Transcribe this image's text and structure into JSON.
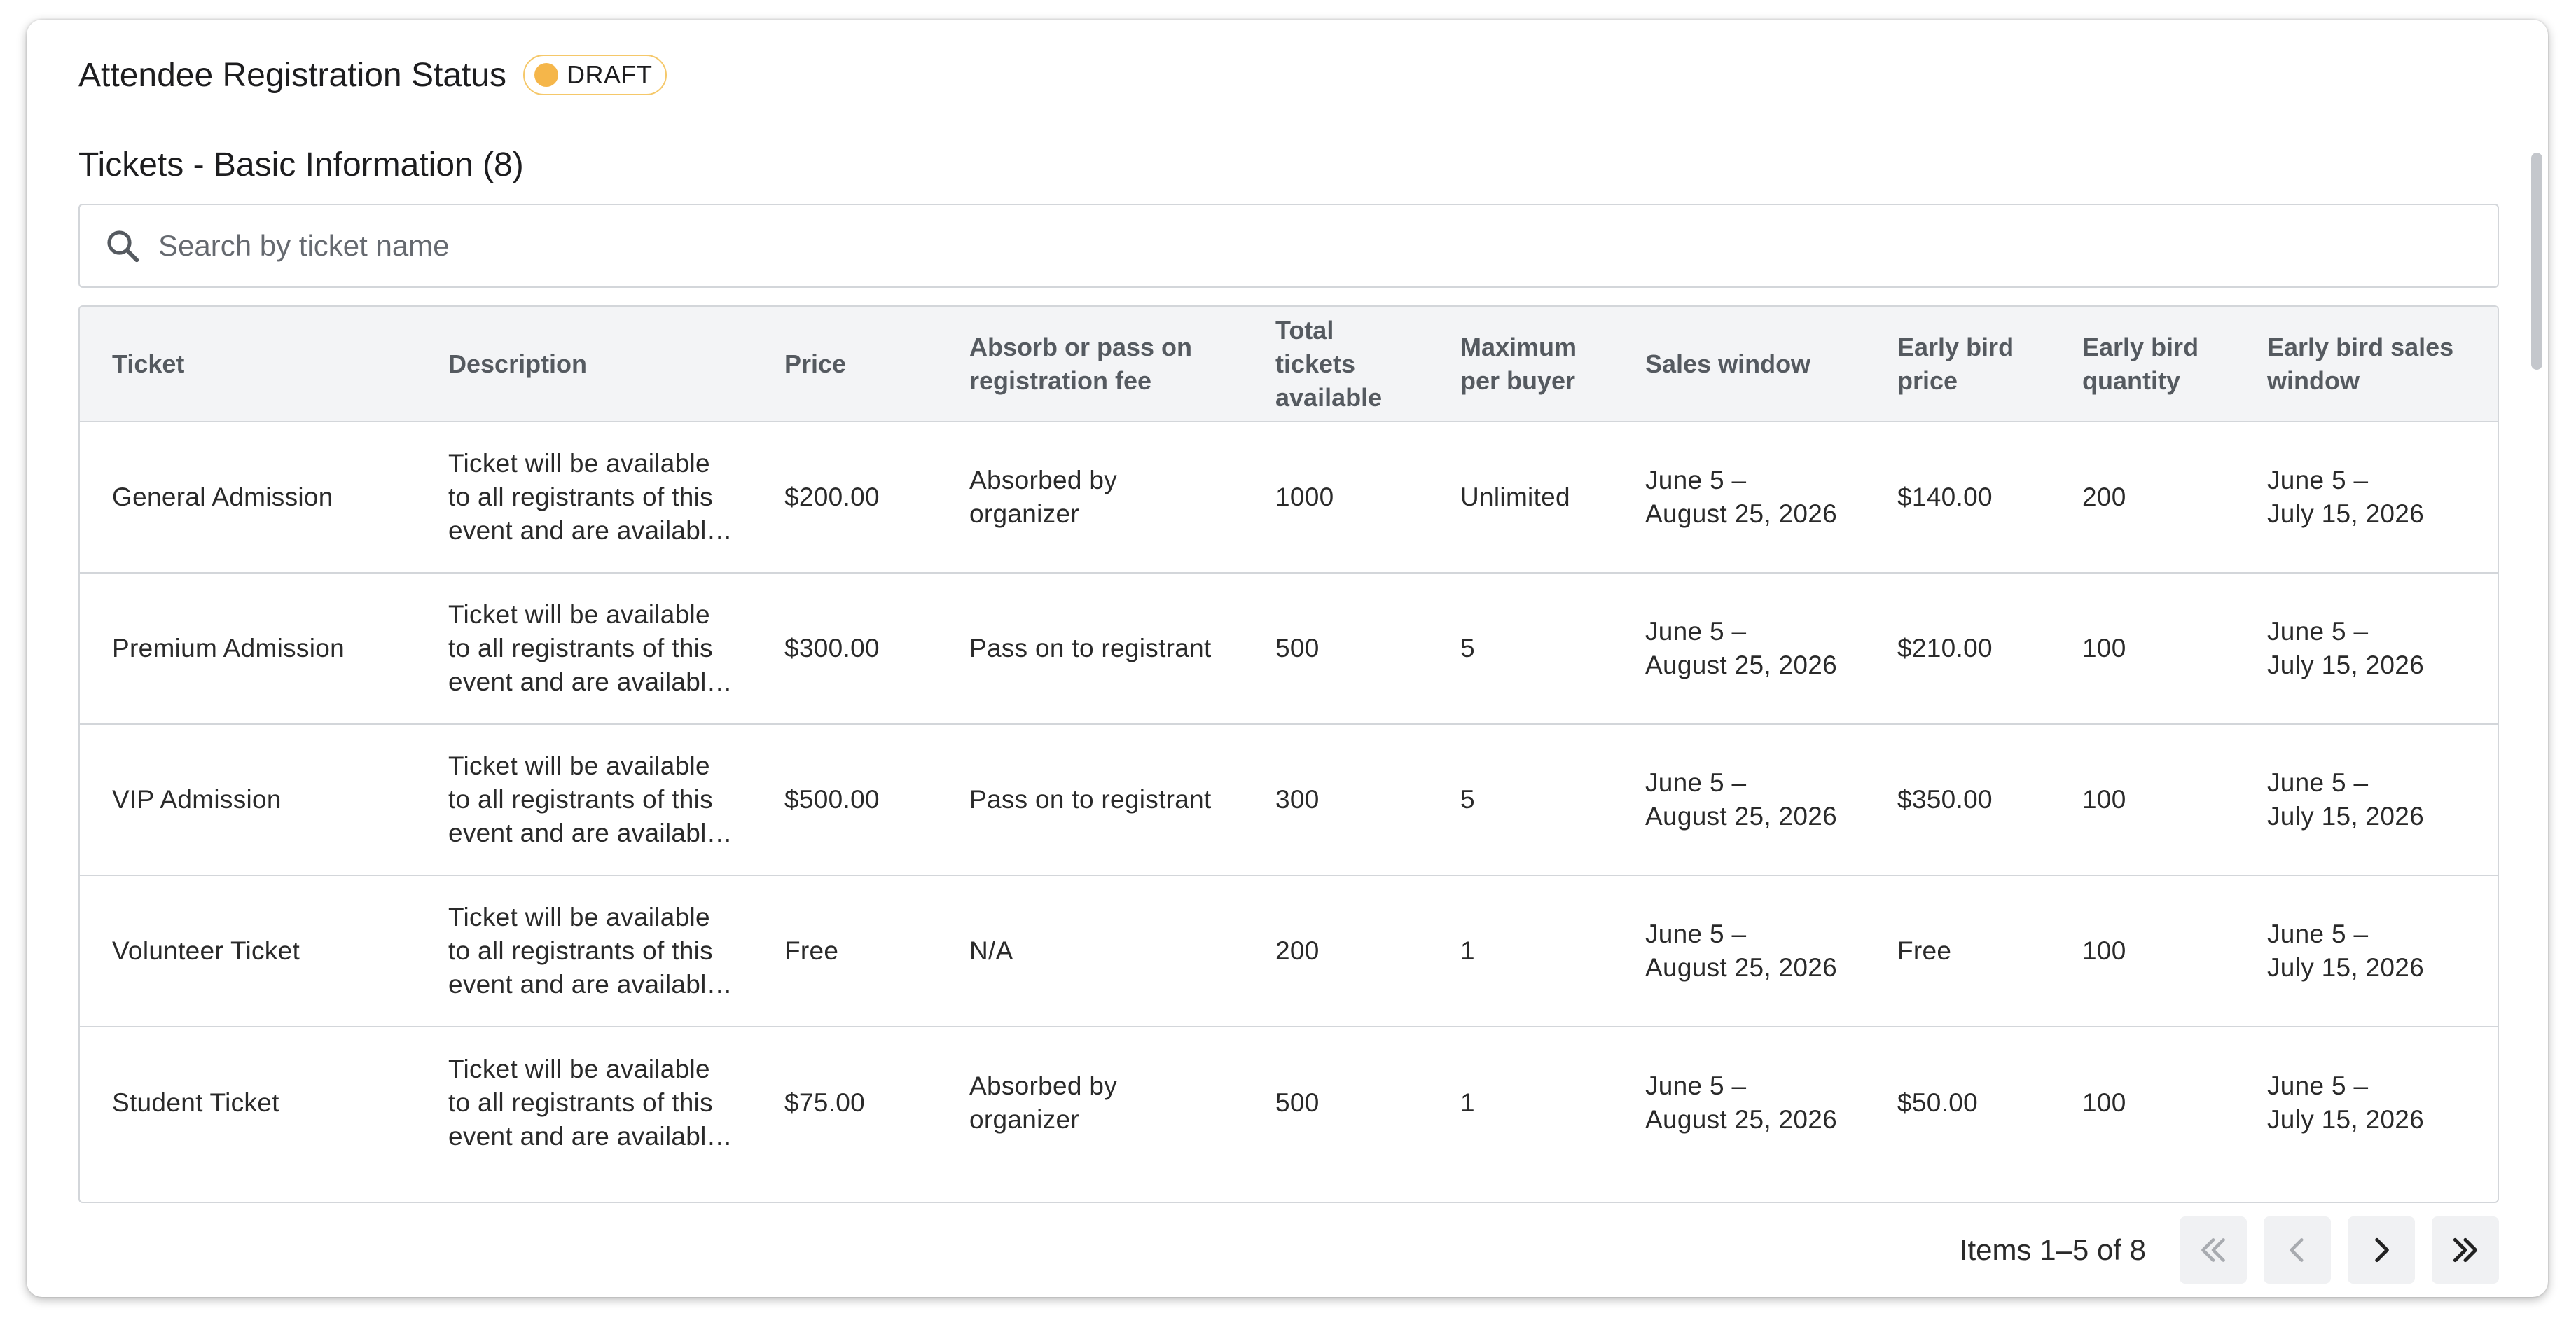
{
  "header": {
    "title": "Attendee Registration Status",
    "status_badge": "DRAFT"
  },
  "section": {
    "title": "Tickets - Basic Information (8)"
  },
  "search": {
    "placeholder": "Search by ticket name",
    "icon": "search-icon"
  },
  "table": {
    "columns": [
      "Ticket",
      "Description",
      "Price",
      "Absorb or pass on registration fee",
      "Total tickets available",
      "Maximum per buyer",
      "Sales window",
      "Early bird price",
      "Early bird quantity",
      "Early bird sales window"
    ],
    "rows": [
      {
        "ticket": "General Admission",
        "description": "Ticket will be available to all registrants of this event and are available for purchase during the sales window",
        "price": "$200.00",
        "fee": "Absorbed by organizer",
        "total": "1000",
        "max_per_buyer": "Unlimited",
        "sales_window_start": "June 5 –",
        "sales_window_end": "August 25, 2026",
        "early_price": "$140.00",
        "early_qty": "200",
        "early_window_start": "June 5 –",
        "early_window_end": "July 15, 2026"
      },
      {
        "ticket": "Premium Admission",
        "description": "Ticket will be available to all registrants of this event and are available for purchase during the sales window",
        "price": "$300.00",
        "fee": "Pass on to registrant",
        "total": "500",
        "max_per_buyer": "5",
        "sales_window_start": "June 5 –",
        "sales_window_end": "August 25, 2026",
        "early_price": "$210.00",
        "early_qty": "100",
        "early_window_start": "June 5 –",
        "early_window_end": "July 15, 2026"
      },
      {
        "ticket": "VIP Admission",
        "description": "Ticket will be available to all registrants of this event and are available for purchase during the sales window",
        "price": "$500.00",
        "fee": "Pass on to registrant",
        "total": "300",
        "max_per_buyer": "5",
        "sales_window_start": "June 5 –",
        "sales_window_end": "August 25, 2026",
        "early_price": "$350.00",
        "early_qty": "100",
        "early_window_start": "June 5 –",
        "early_window_end": "July 15, 2026"
      },
      {
        "ticket": "Volunteer Ticket",
        "description": "Ticket will be available to all registrants of this event and are available for purchase during the sales window",
        "price": "Free",
        "fee": "N/A",
        "total": "200",
        "max_per_buyer": "1",
        "sales_window_start": "June 5 –",
        "sales_window_end": "August 25, 2026",
        "early_price": "Free",
        "early_qty": "100",
        "early_window_start": "June 5 –",
        "early_window_end": "July 15, 2026"
      },
      {
        "ticket": "Student Ticket",
        "description": "Ticket will be available to all registrants of this event and are available for purchase during the sales window",
        "price": "$75.00",
        "fee": "Absorbed by organizer",
        "total": "500",
        "max_per_buyer": "1",
        "sales_window_start": "June 5 –",
        "sales_window_end": "August 25, 2026",
        "early_price": "$50.00",
        "early_qty": "100",
        "early_window_start": "June 5 –",
        "early_window_end": "July 15, 2026"
      }
    ]
  },
  "pagination": {
    "items_label": "Items 1–5 of 8",
    "buttons": [
      {
        "name": "first-page-button",
        "icon": "double-chevron-left-icon",
        "enabled": false
      },
      {
        "name": "previous-page-button",
        "icon": "chevron-left-icon",
        "enabled": false
      },
      {
        "name": "next-page-button",
        "icon": "chevron-right-icon",
        "enabled": true
      },
      {
        "name": "last-page-button",
        "icon": "double-chevron-right-icon",
        "enabled": true
      }
    ]
  },
  "colors": {
    "badge_dot": "#f5b64a",
    "badge_border": "#f5c86a",
    "header_bg": "#f3f4f6",
    "border": "#d3d6da",
    "disabled_icon": "#a8abb0",
    "enabled_icon": "#222222"
  }
}
